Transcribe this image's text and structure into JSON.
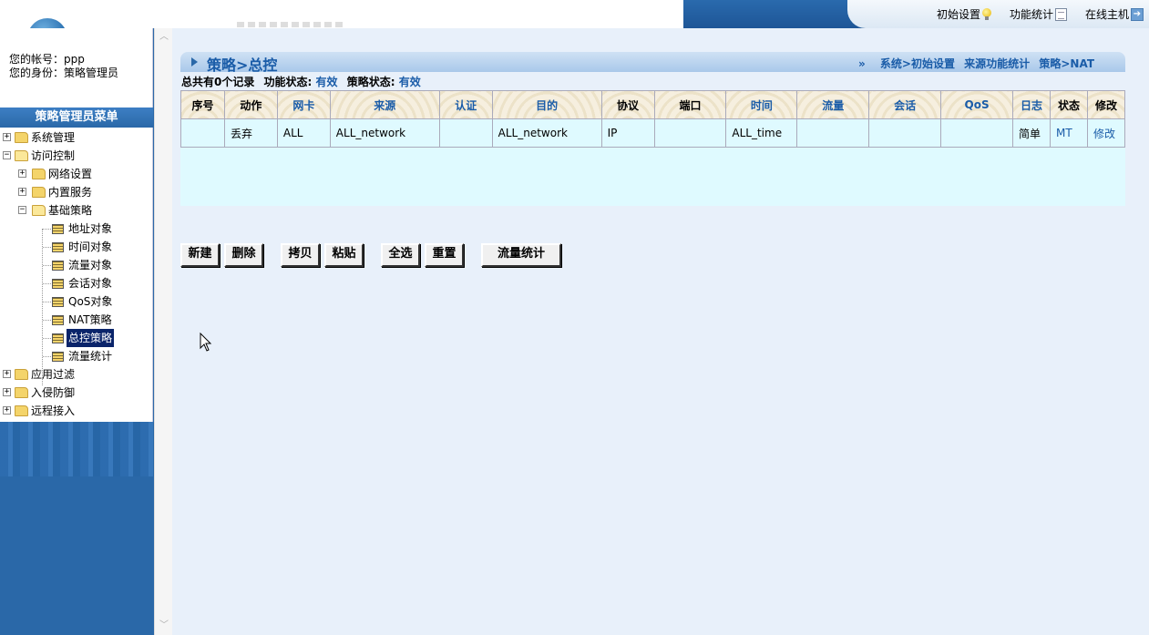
{
  "topbar": {
    "links": [
      {
        "label": "初始设置",
        "icon": "bulb-icon"
      },
      {
        "label": "功能统计",
        "icon": "document-icon"
      },
      {
        "label": "在线主机",
        "icon": "arrow-right-icon"
      }
    ]
  },
  "account": {
    "username_line": "您的帐号：ppp",
    "role_line": "您的身份：策略管理员"
  },
  "menu": {
    "header": "策略管理员菜单",
    "items": [
      {
        "label": "系统管理",
        "level": 0,
        "kind": "folder",
        "state": "collapsed"
      },
      {
        "label": "访问控制",
        "level": 0,
        "kind": "folder",
        "state": "expanded"
      },
      {
        "label": "网络设置",
        "level": 1,
        "kind": "folder",
        "state": "collapsed"
      },
      {
        "label": "内置服务",
        "level": 1,
        "kind": "folder",
        "state": "collapsed"
      },
      {
        "label": "基础策略",
        "level": 1,
        "kind": "folder",
        "state": "expanded"
      },
      {
        "label": "地址对象",
        "level": 2,
        "kind": "page"
      },
      {
        "label": "时间对象",
        "level": 2,
        "kind": "page"
      },
      {
        "label": "流量对象",
        "level": 2,
        "kind": "page"
      },
      {
        "label": "会话对象",
        "level": 2,
        "kind": "page"
      },
      {
        "label": "QoS对象",
        "level": 2,
        "kind": "page"
      },
      {
        "label": "NAT策略",
        "level": 2,
        "kind": "page"
      },
      {
        "label": "总控策略",
        "level": 2,
        "kind": "page",
        "selected": true
      },
      {
        "label": "流量统计",
        "level": 2,
        "kind": "page"
      },
      {
        "label": "应用过滤",
        "level": 0,
        "kind": "folder",
        "state": "collapsed"
      },
      {
        "label": "入侵防御",
        "level": 0,
        "kind": "folder",
        "state": "collapsed"
      },
      {
        "label": "远程接入",
        "level": 0,
        "kind": "folder",
        "state": "collapsed"
      }
    ]
  },
  "page": {
    "title": "策略>总控",
    "breadcrumb_marker": "»",
    "breadcrumb_links": [
      "系统>初始设置",
      "来源功能统计",
      "策略>NAT"
    ],
    "summary_prefix": "总共有0个记录",
    "func_status_label": "功能状态:",
    "func_status_value": "有效",
    "policy_status_label": "策略状态:",
    "policy_status_value": "有效"
  },
  "table": {
    "columns": [
      {
        "label": "序号",
        "blue": false
      },
      {
        "label": "动作",
        "blue": false
      },
      {
        "label": "网卡",
        "blue": true
      },
      {
        "label": "来源",
        "blue": true
      },
      {
        "label": "认证",
        "blue": true
      },
      {
        "label": "目的",
        "blue": true
      },
      {
        "label": "协议",
        "blue": false
      },
      {
        "label": "端口",
        "blue": false
      },
      {
        "label": "时间",
        "blue": true
      },
      {
        "label": "流量",
        "blue": true
      },
      {
        "label": "会话",
        "blue": true
      },
      {
        "label": "QoS",
        "blue": true
      },
      {
        "label": "日志",
        "blue": true
      },
      {
        "label": "状态",
        "blue": false
      },
      {
        "label": "修改",
        "blue": false
      }
    ],
    "rows": [
      [
        "",
        "丢弃",
        "ALL",
        "ALL_network",
        "",
        "ALL_network",
        "IP",
        "",
        "ALL_time",
        "",
        "",
        "",
        "简单",
        "MT",
        "修改"
      ]
    ]
  },
  "buttons": {
    "new": "新建",
    "delete": "删除",
    "copy": "拷贝",
    "paste": "粘贴",
    "select_all": "全选",
    "reset": "重置",
    "traffic_stats": "流量统计"
  },
  "colors": {
    "accent": "#1a5ca8",
    "sidebar": "#2a68a8",
    "table_bg": "#dffaff",
    "selected_node": "#0a246a"
  }
}
